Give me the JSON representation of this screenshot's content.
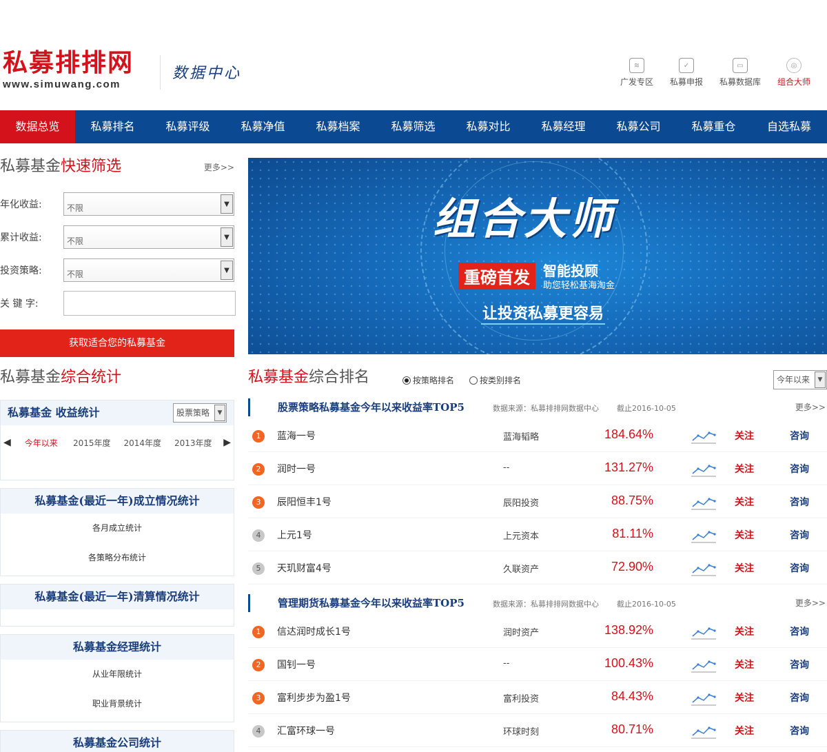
{
  "header": {
    "logo_text": "私募排排网",
    "logo_url": "www.simuwang.com",
    "data_center": "数据中心",
    "top_links": [
      {
        "label": "广发专区",
        "icon": "gf-icon"
      },
      {
        "label": "私募申报",
        "icon": "report-icon"
      },
      {
        "label": "私募数据库",
        "icon": "database-icon"
      },
      {
        "label": "组合大师",
        "icon": "portfolio-master-icon"
      }
    ]
  },
  "nav": [
    "数据总览",
    "私募排名",
    "私募评级",
    "私募净值",
    "私募档案",
    "私募筛选",
    "私募对比",
    "私募经理",
    "私募公司",
    "私募重仓",
    "自选私募"
  ],
  "quick_filter": {
    "title_gray": "私募基金",
    "title_red": "快速筛选",
    "more": "更多>>",
    "rows": [
      {
        "label": "年化收益:",
        "value": "不限"
      },
      {
        "label": "累计收益:",
        "value": "不限"
      },
      {
        "label": "投资策略:",
        "value": "不限"
      }
    ],
    "keyword_label": "关 键 字:",
    "keyword_value": "",
    "button": "获取适合您的私募基金"
  },
  "banner": {
    "title": "组合大师",
    "tag": "重磅首发",
    "sub1": "智能投顾",
    "sub2": "助您轻松基海淘金",
    "slogan": "让投资私募更容易"
  },
  "stats": {
    "title_gray1": "私募基金",
    "title_red": "综合统计",
    "b1_title": "私募基金 收益统计",
    "b1_select": "股票策略",
    "years": [
      "今年以来",
      "2015年度",
      "2014年度",
      "2013年度"
    ],
    "b2_title": "私募基金(最近一年)成立情况统计",
    "b2_links": [
      "各月成立统计",
      "各策略分布统计"
    ],
    "b3_title": "私募基金(最近一年)清算情况统计",
    "b4_title": "私募基金经理统计",
    "b4_links": [
      "从业年限统计",
      "职业背景统计"
    ],
    "b5_title": "私募基金公司统计"
  },
  "ranking": {
    "title_red": "私募基金",
    "title_gray": "综合排名",
    "radio1": "按策略排名",
    "radio2": "按类别排名",
    "period": "今年以来",
    "groups": [
      {
        "title": "股票策略私募基金今年以来收益率TOP5",
        "source": "数据来源：私募排排网数据中心",
        "date": "截止2016-10-05",
        "more": "更多>>",
        "rows": [
          {
            "rank": "1",
            "fund": "蓝海一号",
            "company": "蓝海韬略",
            "rate": "184.64%"
          },
          {
            "rank": "2",
            "fund": "润时一号",
            "company": "--",
            "rate": "131.27%"
          },
          {
            "rank": "3",
            "fund": "辰阳恒丰1号",
            "company": "辰阳投资",
            "rate": "88.75%"
          },
          {
            "rank": "4",
            "fund": "上元1号",
            "company": "上元资本",
            "rate": "81.11%"
          },
          {
            "rank": "5",
            "fund": "天玑财富4号",
            "company": "久联资产",
            "rate": "72.90%"
          }
        ]
      },
      {
        "title": "管理期货私募基金今年以来收益率TOP5",
        "source": "数据来源：私募排排网数据中心",
        "date": "截止2016-10-05",
        "more": "更多>>",
        "rows": [
          {
            "rank": "1",
            "fund": "信达润时成长1号",
            "company": "润时资产",
            "rate": "138.92%"
          },
          {
            "rank": "2",
            "fund": "国钊一号",
            "company": "--",
            "rate": "100.43%"
          },
          {
            "rank": "3",
            "fund": "富利步步为盈1号",
            "company": "富利投资",
            "rate": "84.43%"
          },
          {
            "rank": "4",
            "fund": "汇富环球一号",
            "company": "环球时刻",
            "rate": "80.71%"
          }
        ]
      }
    ],
    "follow_label": "关注",
    "consult_label": "咨询"
  },
  "colors": {
    "brand_red": "#d4121b",
    "nav_blue": "#0b4a93",
    "rank_orange": "#f26522"
  }
}
